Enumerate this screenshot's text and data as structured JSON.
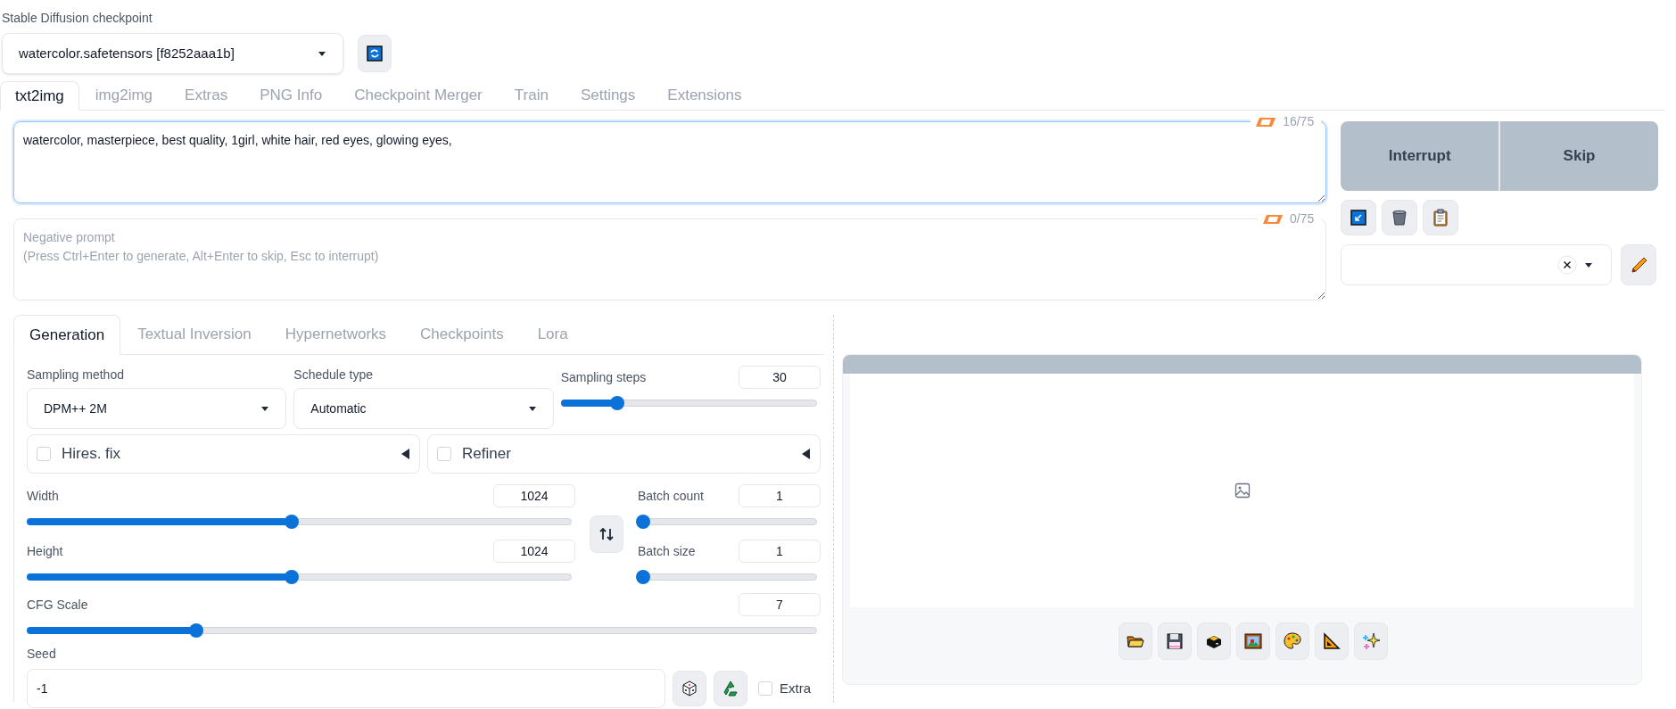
{
  "checkpoint": {
    "label": "Stable Diffusion checkpoint",
    "value": "watercolor.safetensors [f8252aaa1b]"
  },
  "tabs": [
    {
      "label": "txt2img",
      "selected": true
    },
    {
      "label": "img2img",
      "selected": false
    },
    {
      "label": "Extras",
      "selected": false
    },
    {
      "label": "PNG Info",
      "selected": false
    },
    {
      "label": "Checkpoint Merger",
      "selected": false
    },
    {
      "label": "Train",
      "selected": false
    },
    {
      "label": "Settings",
      "selected": false
    },
    {
      "label": "Extensions",
      "selected": false
    }
  ],
  "prompt": {
    "value": "watercolor, masterpiece, best quality, 1girl, white hair, red eyes, glowing eyes,",
    "token_count": "16/75"
  },
  "negative_prompt": {
    "placeholder": "Negative prompt\n(Press Ctrl+Enter to generate, Alt+Enter to skip, Esc to interrupt)",
    "token_count": "0/75"
  },
  "actions": {
    "interrupt": "Interrupt",
    "skip": "Skip"
  },
  "subtabs": [
    {
      "label": "Generation",
      "selected": true
    },
    {
      "label": "Textual Inversion",
      "selected": false
    },
    {
      "label": "Hypernetworks",
      "selected": false
    },
    {
      "label": "Checkpoints",
      "selected": false
    },
    {
      "label": "Lora",
      "selected": false
    }
  ],
  "sampling_method": {
    "label": "Sampling method",
    "value": "DPM++ 2M"
  },
  "schedule_type": {
    "label": "Schedule type",
    "value": "Automatic"
  },
  "sampling_steps": {
    "label": "Sampling steps",
    "value": "30",
    "level": 0.21
  },
  "accordions": [
    {
      "label": "Hires. fix",
      "checked": false
    },
    {
      "label": "Refiner",
      "checked": false
    }
  ],
  "width": {
    "label": "Width",
    "value": "1024",
    "level": 0.485
  },
  "height": {
    "label": "Height",
    "value": "1024",
    "level": 0.485
  },
  "batch_count": {
    "label": "Batch count",
    "value": "1",
    "level": 0
  },
  "batch_size": {
    "label": "Batch size",
    "value": "1",
    "level": 0
  },
  "cfg_scale": {
    "label": "CFG Scale",
    "value": "7",
    "level": 0.21
  },
  "seed": {
    "label": "Seed",
    "value": "-1"
  },
  "extra": {
    "label": "Extra",
    "checked": false
  }
}
